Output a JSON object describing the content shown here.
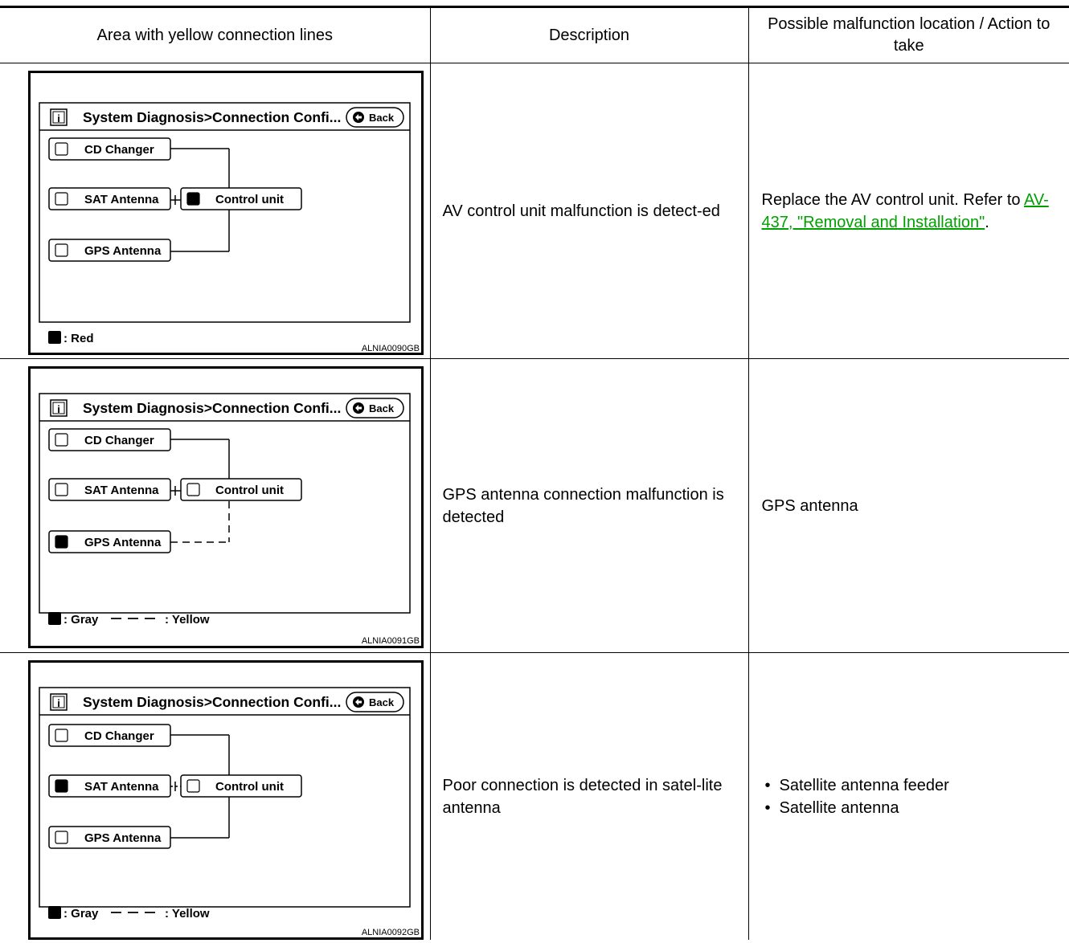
{
  "headers": {
    "col1": "Area with yellow connection lines",
    "col2": "Description",
    "col3": "Possible malfunction location / Action to take"
  },
  "rows": [
    {
      "panel": {
        "title": "System Diagnosis>Connection Confi...",
        "back": "Back",
        "cd": "CD Changer",
        "sat": "SAT Antenna",
        "gps": "GPS Antenna",
        "control": "Control unit",
        "legend_color": ": Red",
        "legend_line": "",
        "code": "ALNIA0090GB"
      },
      "description": "AV control unit malfunction is detect-ed",
      "action_text": "Replace the AV control unit. Refer to ",
      "action_link": "AV-437, \"Removal and Installation\"",
      "action_tail": "."
    },
    {
      "panel": {
        "title": "System Diagnosis>Connection Confi...",
        "back": "Back",
        "cd": "CD Changer",
        "sat": "SAT Antenna",
        "gps": "GPS Antenna",
        "control": "Control unit",
        "legend_color": ": Gray",
        "legend_line": ": Yellow",
        "code": "ALNIA0091GB"
      },
      "description": "GPS antenna connection malfunction is detected",
      "action_text": "GPS antenna"
    },
    {
      "panel": {
        "title": "System Diagnosis>Connection Confi...",
        "back": "Back",
        "cd": "CD Changer",
        "sat": "SAT Antenna",
        "gps": "GPS Antenna",
        "control": "Control unit",
        "legend_color": ": Gray",
        "legend_line": ": Yellow",
        "code": "ALNIA0092GB"
      },
      "description": "Poor connection is detected in satel-lite antenna",
      "action_items": [
        "Satellite antenna feeder",
        "Satellite antenna"
      ]
    }
  ]
}
